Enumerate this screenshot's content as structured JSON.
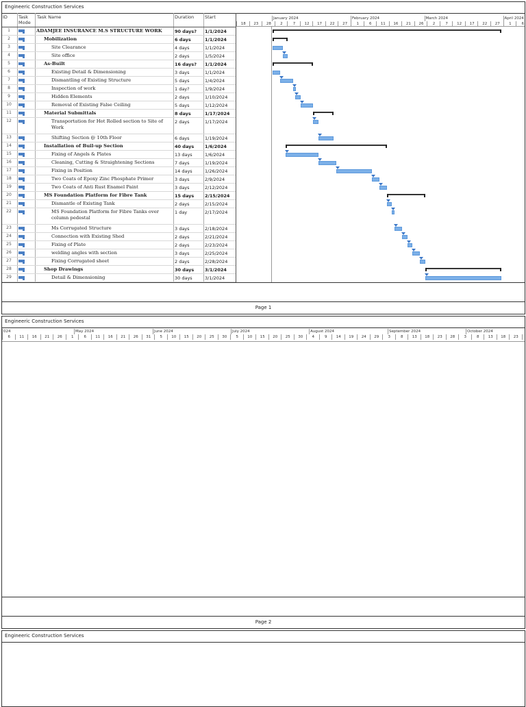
{
  "company": "Engineeric Construction Services",
  "columns": {
    "id": "ID",
    "mode_line1": "Task",
    "mode_line2": "Mode",
    "name": "Task Name",
    "duration": "Duration",
    "start": "Start"
  },
  "tasks": [
    {
      "id": "1",
      "name": "ADAMJEE INSURANCE M.S STRUCTURE WORK",
      "duration": "90 days?",
      "start": "1/1/2024",
      "level": 0,
      "summary": true,
      "days": 90,
      "offset": 0
    },
    {
      "id": "2",
      "name": "Mobilization",
      "duration": "6 days",
      "start": "1/1/2024",
      "level": 1,
      "summary": true,
      "days": 6,
      "offset": 0
    },
    {
      "id": "3",
      "name": "Site Clearance",
      "duration": "4 days",
      "start": "1/1/2024",
      "level": 2,
      "days": 4,
      "offset": 0
    },
    {
      "id": "4",
      "name": "Site office",
      "duration": "2 days",
      "start": "1/5/2024",
      "level": 2,
      "days": 2,
      "offset": 4
    },
    {
      "id": "5",
      "name": "As-Built",
      "duration": "16 days?",
      "start": "1/1/2024",
      "level": 1,
      "summary": true,
      "days": 16,
      "offset": 0
    },
    {
      "id": "6",
      "name": "Existing Detail & Dimensioning",
      "duration": "3 days",
      "start": "1/1/2024",
      "level": 2,
      "days": 3,
      "offset": 0
    },
    {
      "id": "7",
      "name": "Dismantling of Existing Structure",
      "duration": "5 days",
      "start": "1/4/2024",
      "level": 2,
      "days": 5,
      "offset": 3
    },
    {
      "id": "8",
      "name": "Inspection of work",
      "duration": "1 day?",
      "start": "1/9/2024",
      "level": 2,
      "days": 1,
      "offset": 8
    },
    {
      "id": "9",
      "name": "Hidden Elements",
      "duration": "2 days",
      "start": "1/10/2024",
      "level": 2,
      "days": 2,
      "offset": 9
    },
    {
      "id": "10",
      "name": "Removal of Existing False Ceiling",
      "duration": "5 days",
      "start": "1/12/2024",
      "level": 2,
      "days": 5,
      "offset": 11
    },
    {
      "id": "11",
      "name": "Material Submittals",
      "duration": "8 days",
      "start": "1/17/2024",
      "level": 1,
      "summary": true,
      "days": 8,
      "offset": 16
    },
    {
      "id": "12",
      "name": "Transportation for Hot Rolled section to Site of Work",
      "duration": "2 days",
      "start": "1/17/2024",
      "level": 2,
      "days": 2,
      "offset": 16,
      "tall": true
    },
    {
      "id": "13",
      "name": "Shifting Section @ 10th Floor",
      "duration": "6 days",
      "start": "1/19/2024",
      "level": 2,
      "days": 6,
      "offset": 18
    },
    {
      "id": "14",
      "name": "Installation of Buil-up Section",
      "duration": "40 days",
      "start": "1/6/2024",
      "level": 1,
      "summary": true,
      "days": 40,
      "offset": 5
    },
    {
      "id": "15",
      "name": "Fixing of Angels & Plates",
      "duration": "13 days",
      "start": "1/6/2024",
      "level": 2,
      "days": 13,
      "offset": 5
    },
    {
      "id": "16",
      "name": "Cleaning, Cutting & Straightening Sections",
      "duration": "7 days",
      "start": "1/19/2024",
      "level": 2,
      "days": 7,
      "offset": 18
    },
    {
      "id": "17",
      "name": "Fixing in Position",
      "duration": "14 days",
      "start": "1/26/2024",
      "level": 2,
      "days": 14,
      "offset": 25
    },
    {
      "id": "18",
      "name": "Two Coats of Epoxy Zinc Phosphate Primer",
      "duration": "3 days",
      "start": "2/9/2024",
      "level": 2,
      "days": 3,
      "offset": 39
    },
    {
      "id": "19",
      "name": "Two Coats of Anti Rust Enamel Paint",
      "duration": "3 days",
      "start": "2/12/2024",
      "level": 2,
      "days": 3,
      "offset": 42
    },
    {
      "id": "20",
      "name": "MS Foundation Platform for Fibre Tank",
      "duration": "15 days",
      "start": "2/15/2024",
      "level": 1,
      "summary": true,
      "days": 15,
      "offset": 45
    },
    {
      "id": "21",
      "name": "Dismantle of Existing Tank",
      "duration": "2 days",
      "start": "2/15/2024",
      "level": 2,
      "days": 2,
      "offset": 45
    },
    {
      "id": "22",
      "name": "MS Foundation Platform for Fibre Tanks over column pedestal",
      "duration": "1 day",
      "start": "2/17/2024",
      "level": 2,
      "days": 1,
      "offset": 47,
      "tall": true
    },
    {
      "id": "23",
      "name": "Ms  Corrugated Structure",
      "duration": "3 days",
      "start": "2/18/2024",
      "level": 2,
      "days": 3,
      "offset": 48
    },
    {
      "id": "24",
      "name": "Connection with Existing Shed",
      "duration": "2 days",
      "start": "2/21/2024",
      "level": 2,
      "days": 2,
      "offset": 51
    },
    {
      "id": "25",
      "name": "Fixing of Plate",
      "duration": "2 days",
      "start": "2/23/2024",
      "level": 2,
      "days": 2,
      "offset": 53
    },
    {
      "id": "26",
      "name": "welding angles with section",
      "duration": "3 days",
      "start": "2/25/2024",
      "level": 2,
      "days": 3,
      "offset": 55
    },
    {
      "id": "27",
      "name": "Fixing Corrugated sheet",
      "duration": "2 days",
      "start": "2/28/2024",
      "level": 2,
      "days": 2,
      "offset": 58
    },
    {
      "id": "28",
      "name": "Shop Drawings",
      "duration": "30 days",
      "start": "3/1/2024",
      "level": 1,
      "summary": true,
      "days": 30,
      "offset": 60
    },
    {
      "id": "29",
      "name": "Detail & Dimensioning",
      "duration": "30 days",
      "start": "3/1/2024",
      "level": 2,
      "days": 30,
      "offset": 60
    }
  ],
  "timeline1": {
    "months": [
      {
        "label": "January 2024",
        "day": 14
      },
      {
        "label": "February 2024",
        "day": 45
      },
      {
        "label": "March 2024",
        "day": 74
      },
      {
        "label": "April 2024",
        "day": 105
      }
    ],
    "ticks": [
      "18",
      "23",
      "28",
      "2",
      "7",
      "12",
      "17",
      "22",
      "27",
      "1",
      "6",
      "11",
      "16",
      "21",
      "26",
      "2",
      "7",
      "12",
      "17",
      "22",
      "27",
      "1",
      "6"
    ]
  },
  "timeline2": {
    "months": [
      {
        "label": "024",
        "pos": 0
      },
      {
        "label": "May 2024",
        "pos": 1
      },
      {
        "label": "June 2024",
        "pos": 2
      },
      {
        "label": "July 2024",
        "pos": 3
      },
      {
        "label": "August 2024",
        "pos": 4
      },
      {
        "label": "September 2024",
        "pos": 5
      },
      {
        "label": "October 2024",
        "pos": 6
      }
    ],
    "ticks": [
      "6",
      "11",
      "16",
      "21",
      "26",
      "1",
      "6",
      "11",
      "16",
      "21",
      "26",
      "31",
      "5",
      "10",
      "15",
      "20",
      "25",
      "30",
      "5",
      "10",
      "15",
      "20",
      "25",
      "30",
      "4",
      "9",
      "14",
      "19",
      "24",
      "29",
      "3",
      "8",
      "13",
      "18",
      "23",
      "28",
      "3",
      "8",
      "13",
      "18",
      "23",
      "2"
    ]
  },
  "pages": [
    "Page 1",
    "Page 2"
  ],
  "colors": {
    "bar": "#7cb0e8",
    "mode": "#4a7fc4"
  }
}
